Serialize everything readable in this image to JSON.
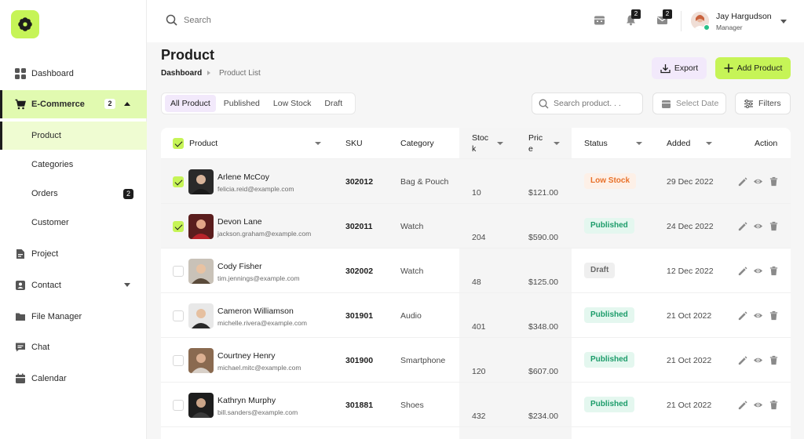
{
  "topbar": {
    "search_placeholder": "Search",
    "notifications_count": "2",
    "messages_count": "2",
    "user_name": "Jay Hargudson",
    "user_role": "Manager"
  },
  "sidebar": {
    "items": [
      {
        "label": "Dashboard"
      },
      {
        "label": "E-Commerce",
        "badge": "2"
      },
      {
        "label": "Project"
      },
      {
        "label": "Contact"
      },
      {
        "label": "File Manager"
      },
      {
        "label": "Chat"
      },
      {
        "label": "Calendar"
      }
    ],
    "sub_items": [
      {
        "label": "Product"
      },
      {
        "label": "Categories"
      },
      {
        "label": "Orders",
        "badge": "2"
      },
      {
        "label": "Customer"
      }
    ]
  },
  "header": {
    "title": "Product",
    "breadcrumb": [
      "Dashboard",
      "Product List"
    ],
    "export_label": "Export",
    "add_label": "Add Product"
  },
  "filters": {
    "tabs": [
      "All Product",
      "Published",
      "Low Stock",
      "Draft"
    ],
    "active_tab": "All Product",
    "search_placeholder": "Search product. . .",
    "date_label": "Select Date",
    "filters_label": "Filters"
  },
  "table": {
    "columns": {
      "product": "Product",
      "sku": "SKU",
      "category": "Category",
      "stock_1": "Stoc",
      "stock_2": "k",
      "price_1": "Pric",
      "price_2": "e",
      "status": "Status",
      "added": "Added",
      "action": "Action"
    },
    "rows": [
      {
        "name": "Arlene McCoy",
        "email": "felicia.reid@example.com",
        "sku": "302012",
        "category": "Bag & Pouch",
        "stock": "10",
        "price": "$121.00",
        "status": "Low Stock",
        "added": "29 Dec 2022",
        "selected": true
      },
      {
        "name": "Devon Lane",
        "email": "jackson.graham@example.com",
        "sku": "302011",
        "category": "Watch",
        "stock": "204",
        "price": "$590.00",
        "status": "Published",
        "added": "24 Dec 2022",
        "selected": true
      },
      {
        "name": "Cody Fisher",
        "email": "tim.jennings@example.com",
        "sku": "302002",
        "category": "Watch",
        "stock": "48",
        "price": "$125.00",
        "status": "Draft",
        "added": "12 Dec 2022",
        "selected": false
      },
      {
        "name": "Cameron Williamson",
        "email": "michelle.rivera@example.com",
        "sku": "301901",
        "category": "Audio",
        "stock": "401",
        "price": "$348.00",
        "status": "Published",
        "added": "21 Oct 2022",
        "selected": false
      },
      {
        "name": "Courtney Henry",
        "email": "michael.mitc@example.com",
        "sku": "301900",
        "category": "Smartphone",
        "stock": "120",
        "price": "$607.00",
        "status": "Published",
        "added": "21 Oct 2022",
        "selected": false
      },
      {
        "name": "Kathryn Murphy",
        "email": "bill.sanders@example.com",
        "sku": "301881",
        "category": "Shoes",
        "stock": "432",
        "price": "$234.00",
        "status": "Published",
        "added": "21 Oct 2022",
        "selected": false
      }
    ]
  },
  "colors": {
    "accent": "#c6f457",
    "accent_light": "#e1fab0",
    "export_bg": "#f2e9fb",
    "low_stock": "#e8712a",
    "published": "#1c9c6a"
  }
}
